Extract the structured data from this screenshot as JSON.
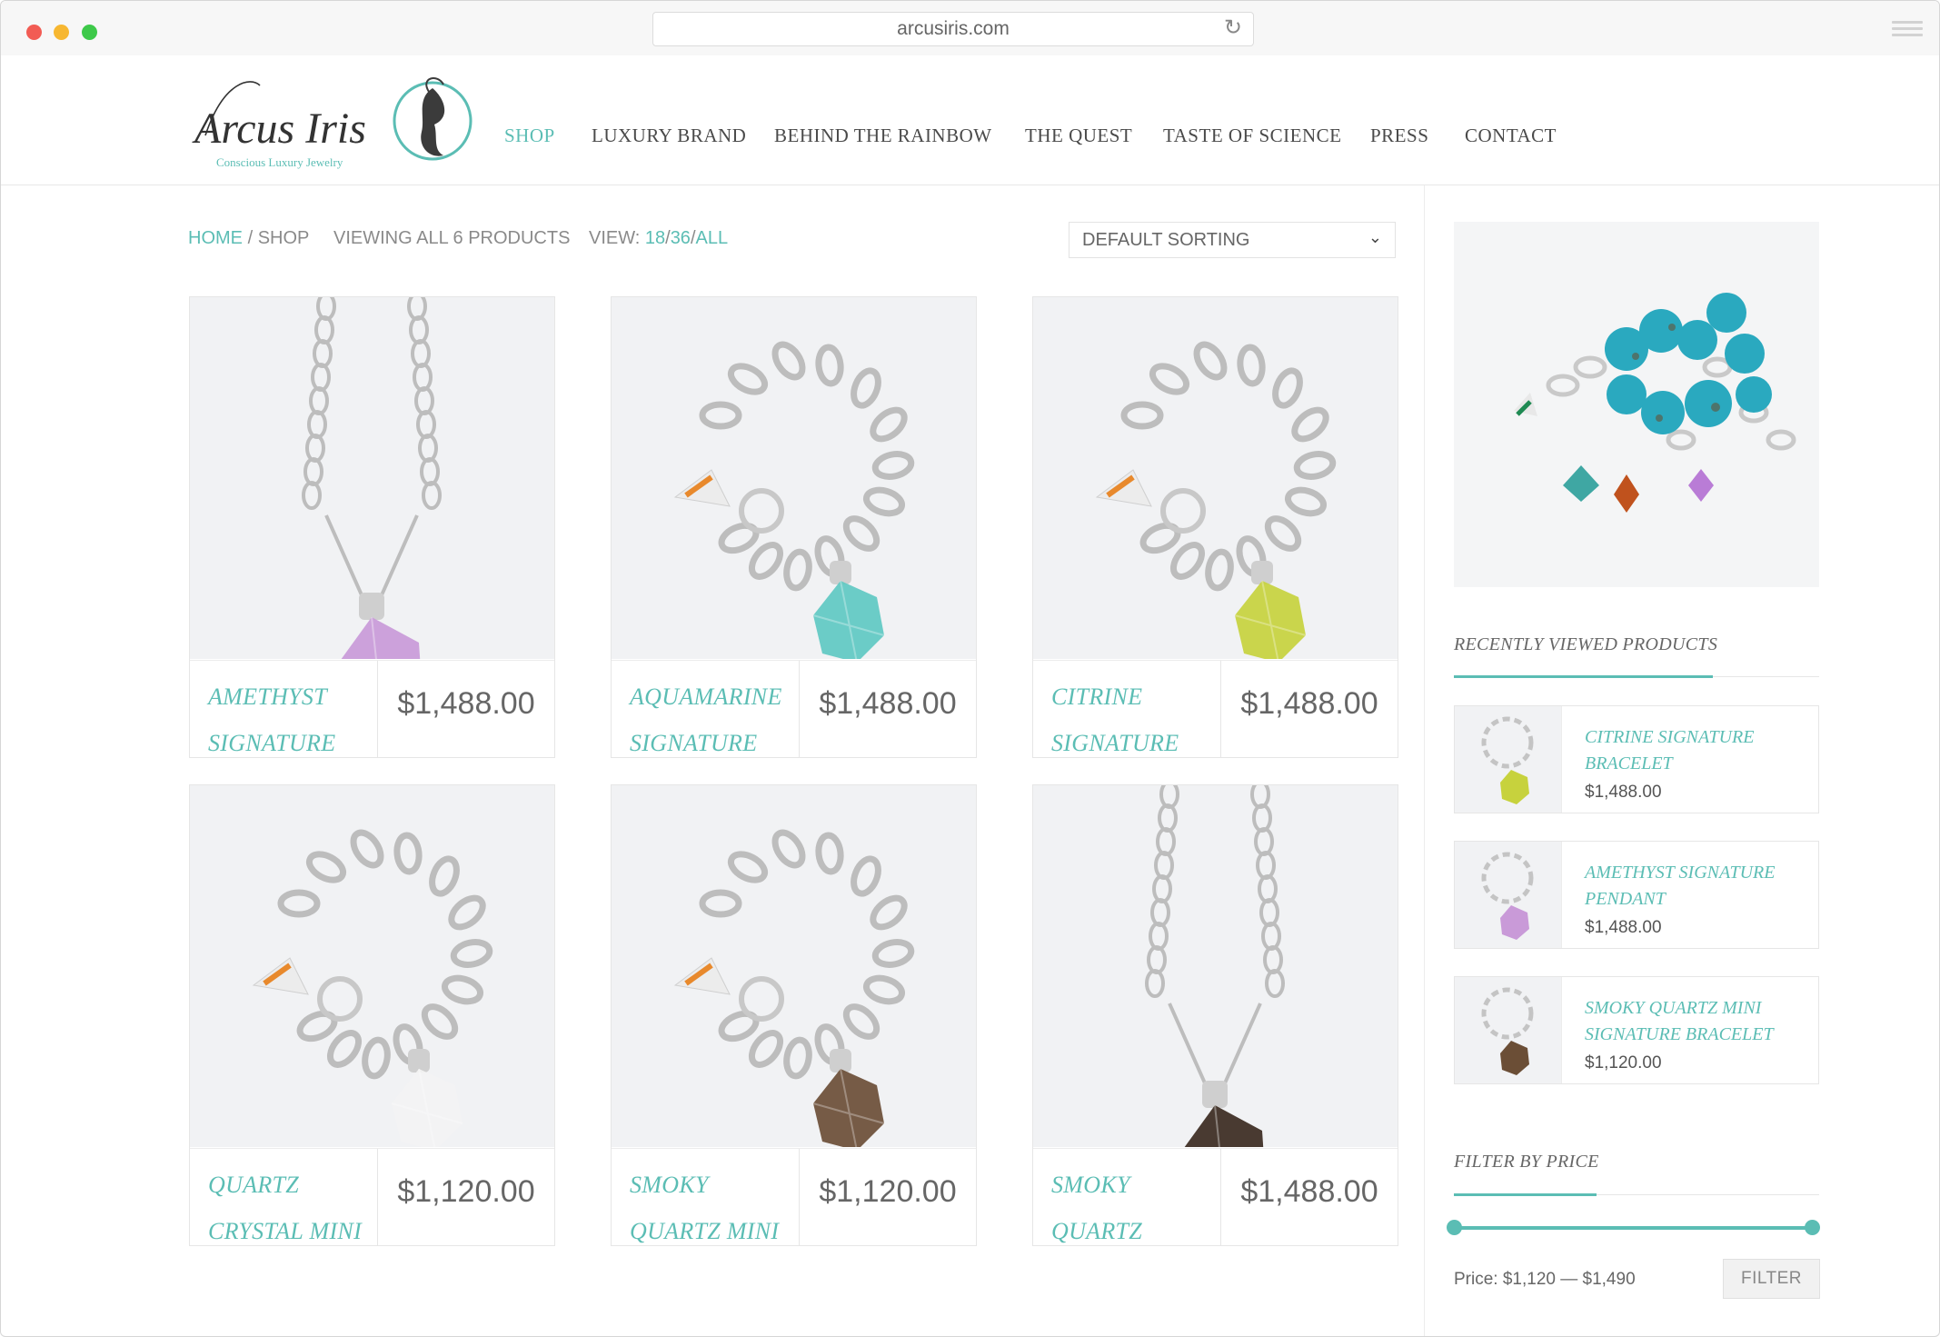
{
  "browser": {
    "url": "arcusiris.com"
  },
  "brand": {
    "name": "Arcus Iris",
    "tagline": "Conscious Luxury Jewelry",
    "accent_color": "#5bbdb4"
  },
  "nav": {
    "items": [
      {
        "label": "SHOP",
        "active": true
      },
      {
        "label": "LUXURY BRAND"
      },
      {
        "label": "BEHIND THE RAINBOW"
      },
      {
        "label": "THE QUEST"
      },
      {
        "label": "TASTE OF SCIENCE"
      },
      {
        "label": "PRESS"
      },
      {
        "label": "CONTACT"
      }
    ]
  },
  "toolbar": {
    "breadcrumb_home": "HOME",
    "breadcrumb_sep": "/",
    "breadcrumb_current": "SHOP",
    "viewing": "VIEWING ALL 6 PRODUCTS",
    "view_label": "VIEW:",
    "view_18": "18",
    "view_36": "36",
    "view_all": "ALL",
    "view_sep": "/",
    "sort_selected": "DEFAULT SORTING"
  },
  "products": [
    {
      "name": "AMETHYST SIGNATURE",
      "price": "$1,488.00",
      "stone": "amethyst",
      "stone_color": "#c99ad8",
      "type": "pendant"
    },
    {
      "name": "AQUAMARINE SIGNATURE",
      "price": "$1,488.00",
      "stone": "aquamarine",
      "stone_color": "#5fc9c2",
      "type": "bracelet"
    },
    {
      "name": "CITRINE SIGNATURE",
      "price": "$1,488.00",
      "stone": "citrine",
      "stone_color": "#c7d23d",
      "type": "bracelet"
    },
    {
      "name": "QUARTZ CRYSTAL MINI",
      "price": "$1,120.00",
      "stone": "quartz",
      "stone_color": "#f3f3f3",
      "type": "bracelet"
    },
    {
      "name": "SMOKY QUARTZ MINI",
      "price": "$1,120.00",
      "stone": "smoky quartz",
      "stone_color": "#6b4e36",
      "type": "bracelet"
    },
    {
      "name": "SMOKY QUARTZ",
      "price": "$1,488.00",
      "stone": "smoky quartz",
      "stone_color": "#3b2a20",
      "type": "pendant"
    }
  ],
  "sidebar": {
    "recently_viewed_title": "RECENTLY VIEWED PRODUCTS",
    "recently_viewed": [
      {
        "name": "CITRINE SIGNATURE BRACELET",
        "price": "$1,488.00",
        "stone_color": "#c7d23d"
      },
      {
        "name": "AMETHYST SIGNATURE PENDANT",
        "price": "$1,488.00",
        "stone_color": "#c99ad8"
      },
      {
        "name": "SMOKY QUARTZ MINI SIGNATURE BRACELET",
        "price": "$1,120.00",
        "stone_color": "#6b4e36"
      }
    ],
    "filter_title": "FILTER BY PRICE",
    "price_range_label": "Price: $1,120 — $1,490",
    "filter_button": "FILTER",
    "price_min": 1120,
    "price_max": 1490
  }
}
